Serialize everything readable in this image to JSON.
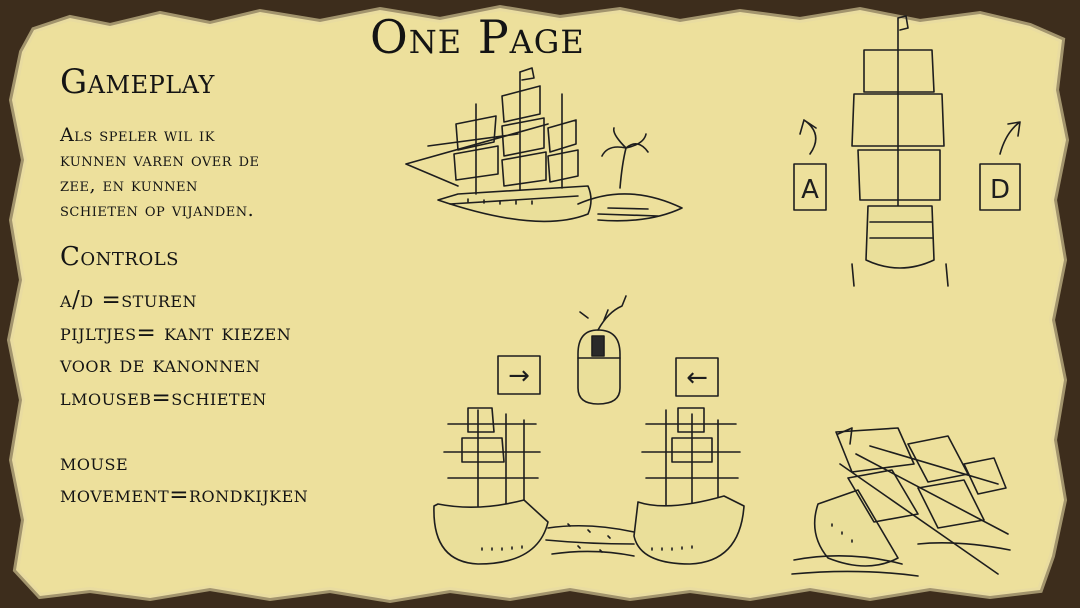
{
  "title": "One Page",
  "gameplay": {
    "heading": "Gameplay",
    "lines": [
      "Als speler wil ik",
      "kunnen varen over de",
      "zee, en kunnen",
      "schieten op vijanden."
    ]
  },
  "controls": {
    "heading": "Controls",
    "lines": [
      "a/d =sturen",
      "pijltjes= kant kiezen",
      "voor de kanonnen",
      "lmouseb=schieten",
      "",
      "mouse",
      "movement=rondkijken"
    ]
  },
  "sketches": {
    "key_left": "A",
    "key_right": "D",
    "arrow_right": "→",
    "arrow_left": "←"
  },
  "colors": {
    "parchment": "#ede09c",
    "border": "#3d2d1c",
    "ink": "#1e1e1e"
  }
}
